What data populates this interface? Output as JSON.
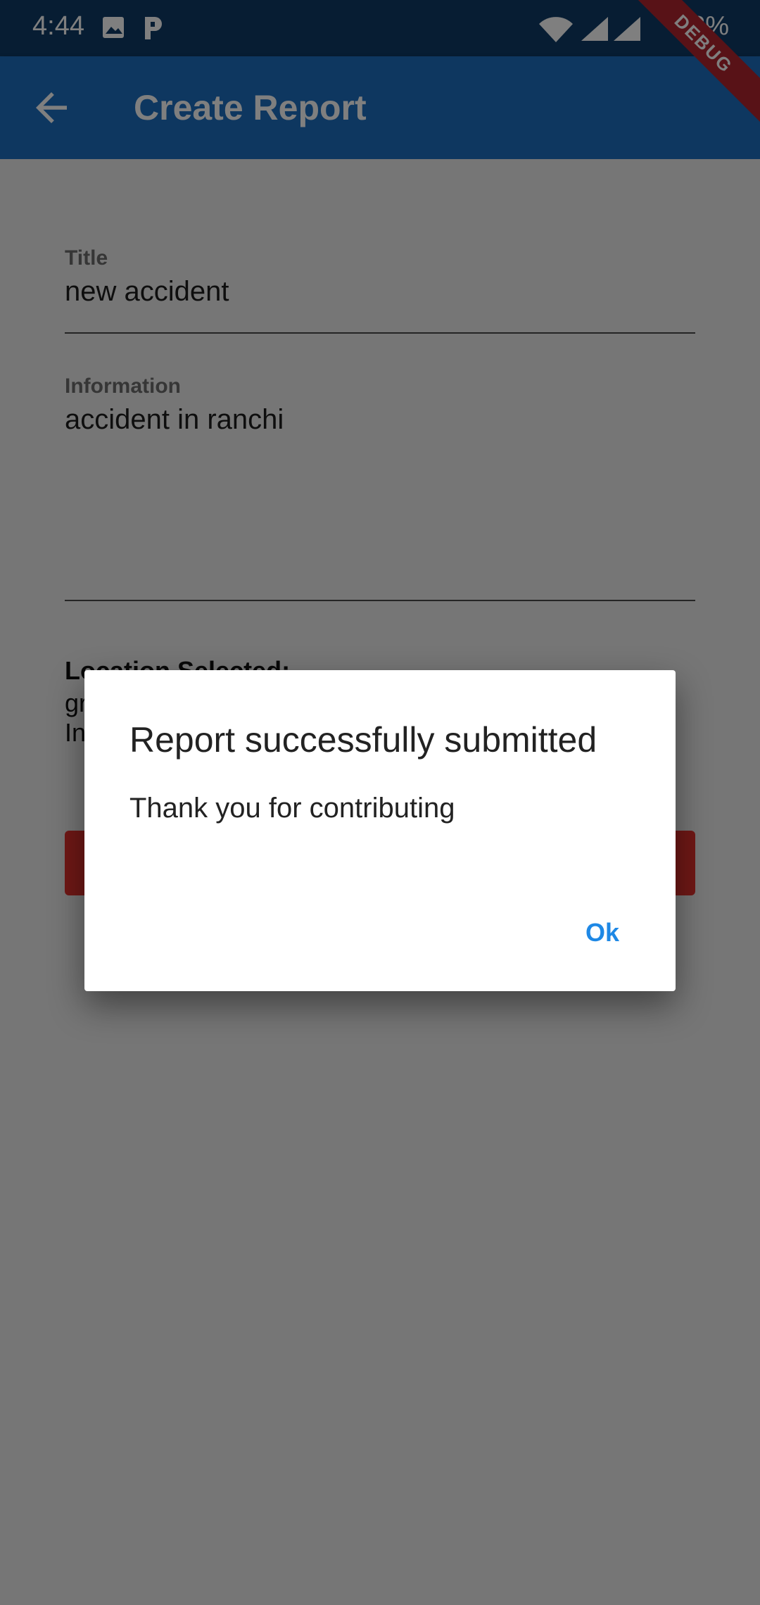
{
  "status_bar": {
    "time": "4:44",
    "battery": "98%"
  },
  "app_bar": {
    "title": "Create Report",
    "debug_banner": "DEBUG"
  },
  "form": {
    "title_label": "Title",
    "title_value": "new accident",
    "info_label": "Information",
    "info_value": "accident in ranchi",
    "location_label": "Location Selected:",
    "location_line1": "gr",
    "location_line2": "In"
  },
  "dialog": {
    "title": "Report successfully submitted",
    "body": "Thank you for contributing",
    "ok_label": "Ok"
  },
  "colors": {
    "status_bar": "#0e3a66",
    "app_bar": "#1d6fc0",
    "submit_button": "#e0302d",
    "dialog_action": "#1e88e5"
  }
}
